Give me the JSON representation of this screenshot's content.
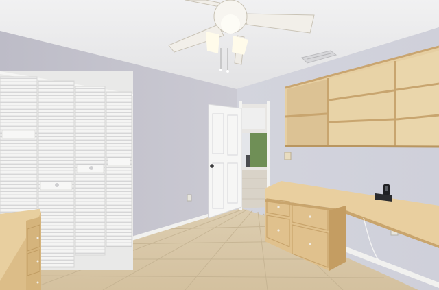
{
  "scene": {
    "kind": "interior-photo",
    "colors": {
      "ceiling": "#e9e9ea",
      "wall_left": "#c4c3cd",
      "wall_right": "#cfd0da",
      "floor": "#d9c8a8",
      "floor_grout": "#c4b292",
      "closet_door": "#f3f3f2",
      "door": "#f6f6f5",
      "wood": "#e2c796",
      "wood_dark": "#c9a873",
      "baseboard": "#f1f1ef"
    },
    "objects": [
      {
        "name": "ceiling-fan",
        "icon": "ceiling-fan-icon"
      },
      {
        "name": "air-vent",
        "icon": "vent-icon"
      },
      {
        "name": "bifold-closet-doors",
        "icon": "closet-icon"
      },
      {
        "name": "interior-door",
        "icon": "door-icon"
      },
      {
        "name": "hallway-opening",
        "icon": "doorway-icon"
      },
      {
        "name": "wall-shelves",
        "icon": "shelf-icon"
      },
      {
        "name": "built-in-desk",
        "icon": "desk-icon"
      },
      {
        "name": "desk-telephone",
        "icon": "phone-icon"
      },
      {
        "name": "wooden-cabinet",
        "icon": "cabinet-icon"
      },
      {
        "name": "tile-floor",
        "icon": "floor-icon"
      }
    ]
  }
}
